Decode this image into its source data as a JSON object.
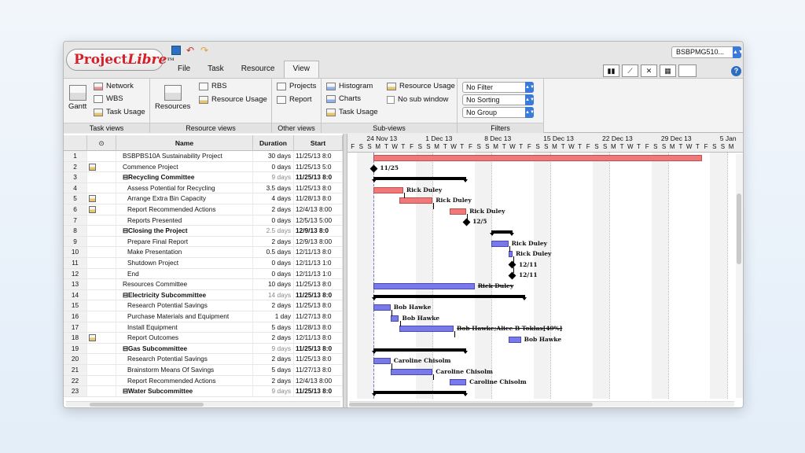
{
  "app": {
    "logo": "ProjectLibre",
    "logo_tm": "TM",
    "project_selector": "BSBPMG510..."
  },
  "menu": [
    "File",
    "Task",
    "Resource",
    "View"
  ],
  "ribbon": {
    "task_views": {
      "title": "Task views",
      "gantt": "Gantt",
      "network": "Network",
      "wbs": "WBS",
      "task_usage": "Task Usage"
    },
    "resource_views": {
      "title": "Resource views",
      "resources": "Resources",
      "rbs": "RBS",
      "resource_usage": "Resource Usage"
    },
    "other_views": {
      "title": "Other views",
      "projects": "Projects",
      "report": "Report"
    },
    "sub_views": {
      "title": "Sub-views",
      "histogram": "Histogram",
      "charts": "Charts",
      "task_usage": "Task Usage",
      "resource_usage": "Resource Usage",
      "no_sub_window": "No sub window"
    },
    "filters": {
      "title": "Filters",
      "filter": "No Filter",
      "sorting": "No Sorting",
      "group": "No Group"
    }
  },
  "table": {
    "columns": {
      "info": "⊙",
      "name": "Name",
      "duration": "Duration",
      "start": "Start"
    },
    "rows": [
      {
        "id": "1",
        "name": "BSBPBS10A Sustainability Project",
        "duration": "30 days",
        "start": "11/25/13 8:0",
        "level": 0,
        "summary": false,
        "note": false
      },
      {
        "id": "2",
        "name": "Commence Project",
        "duration": "0 days",
        "start": "11/25/13 5:0",
        "level": 0,
        "summary": false,
        "note": true
      },
      {
        "id": "3",
        "name": "⊟Recycling Committee",
        "duration": "9 days",
        "start": "11/25/13 8:0",
        "level": 0,
        "summary": true,
        "note": false
      },
      {
        "id": "4",
        "name": "Assess Potential for Recycling",
        "duration": "3.5 days",
        "start": "11/25/13 8:0",
        "level": 1,
        "summary": false,
        "note": false
      },
      {
        "id": "5",
        "name": "Arrange Extra Bin Capacity",
        "duration": "4 days",
        "start": "11/28/13 8:0",
        "level": 1,
        "summary": false,
        "note": true
      },
      {
        "id": "6",
        "name": "Report Recommended Actions",
        "duration": "2 days",
        "start": "12/4/13 8:00",
        "level": 1,
        "summary": false,
        "note": true
      },
      {
        "id": "7",
        "name": "Reports Presented",
        "duration": "0 days",
        "start": "12/5/13 5:00",
        "level": 1,
        "summary": false,
        "note": false
      },
      {
        "id": "8",
        "name": "⊟Closing the Project",
        "duration": "2.5 days",
        "start": "12/9/13 8:0",
        "level": 0,
        "summary": true,
        "note": false
      },
      {
        "id": "9",
        "name": "Prepare Final Report",
        "duration": "2 days",
        "start": "12/9/13 8:00",
        "level": 1,
        "summary": false,
        "note": false
      },
      {
        "id": "10",
        "name": "Make Presentation",
        "duration": "0.5 days",
        "start": "12/11/13 8:0",
        "level": 1,
        "summary": false,
        "note": false
      },
      {
        "id": "11",
        "name": "Shutdown Project",
        "duration": "0 days",
        "start": "12/11/13 1:0",
        "level": 1,
        "summary": false,
        "note": false
      },
      {
        "id": "12",
        "name": "End",
        "duration": "0 days",
        "start": "12/11/13 1:0",
        "level": 1,
        "summary": false,
        "note": false
      },
      {
        "id": "13",
        "name": "Resources Committee",
        "duration": "10 days",
        "start": "11/25/13 8:0",
        "level": 0,
        "summary": false,
        "note": false
      },
      {
        "id": "14",
        "name": "⊟Electricity Subcommittee",
        "duration": "14 days",
        "start": "11/25/13 8:0",
        "level": 0,
        "summary": true,
        "note": false
      },
      {
        "id": "15",
        "name": "Research Potential Savings",
        "duration": "2 days",
        "start": "11/25/13 8:0",
        "level": 1,
        "summary": false,
        "note": false
      },
      {
        "id": "16",
        "name": "Purchase Materials and Equipment",
        "duration": "1 day",
        "start": "11/27/13 8:0",
        "level": 1,
        "summary": false,
        "note": false
      },
      {
        "id": "17",
        "name": "Install Equipment",
        "duration": "5 days",
        "start": "11/28/13 8:0",
        "level": 1,
        "summary": false,
        "note": false
      },
      {
        "id": "18",
        "name": "Report Outcomes",
        "duration": "2 days",
        "start": "12/11/13 8:0",
        "level": 1,
        "summary": false,
        "note": true
      },
      {
        "id": "19",
        "name": "⊟Gas Subcommittee",
        "duration": "9 days",
        "start": "11/25/13 8:0",
        "level": 0,
        "summary": true,
        "note": false
      },
      {
        "id": "20",
        "name": "Research Potential Savings",
        "duration": "2 days",
        "start": "11/25/13 8:0",
        "level": 1,
        "summary": false,
        "note": false
      },
      {
        "id": "21",
        "name": "Brainstorm Means Of Savings",
        "duration": "5 days",
        "start": "11/27/13 8:0",
        "level": 1,
        "summary": false,
        "note": false
      },
      {
        "id": "22",
        "name": "Report Recommended Actions",
        "duration": "2 days",
        "start": "12/4/13 8:00",
        "level": 1,
        "summary": false,
        "note": false
      },
      {
        "id": "23",
        "name": "⊟Water Subcommittee",
        "duration": "9 days",
        "start": "11/25/13 8:0",
        "level": 0,
        "summary": true,
        "note": false
      }
    ]
  },
  "gantt": {
    "weeks": [
      "24 Nov 13",
      "1 Dec 13",
      "8 Dec 13",
      "15 Dec 13",
      "22 Dec 13",
      "29 Dec 13",
      "5 Jan"
    ],
    "first_day_letters": [
      "F",
      "S"
    ],
    "week_day_letters": [
      "S",
      "M",
      "T",
      "W",
      "T",
      "F",
      "S"
    ],
    "colors": {
      "task_bar": "#f07878",
      "resource_bar": "#7979ea",
      "summary_bar": "#000000"
    },
    "bars": [
      {
        "row": 0,
        "type": "red",
        "start": 2,
        "end": 41
      },
      {
        "row": 1,
        "type": "milestone",
        "at": 2,
        "label": "11/25"
      },
      {
        "row": 2,
        "type": "summary",
        "start": 2,
        "end": 13
      },
      {
        "row": 3,
        "type": "red",
        "start": 2,
        "end": 5.5,
        "label": "Rick Duley"
      },
      {
        "row": 4,
        "type": "red",
        "start": 5,
        "end": 9,
        "label": "Rick Duley"
      },
      {
        "row": 5,
        "type": "red",
        "start": 11,
        "end": 13,
        "label": "Rick Duley"
      },
      {
        "row": 6,
        "type": "milestone",
        "at": 13,
        "label": "12/5"
      },
      {
        "row": 7,
        "type": "summary",
        "start": 16,
        "end": 18.5
      },
      {
        "row": 8,
        "type": "blue",
        "start": 16,
        "end": 18,
        "label": "Rick Duley"
      },
      {
        "row": 9,
        "type": "blue",
        "start": 18,
        "end": 18.5,
        "label": "Rick Duley"
      },
      {
        "row": 10,
        "type": "milestone",
        "at": 18.5,
        "label": "12/11"
      },
      {
        "row": 11,
        "type": "milestone",
        "at": 18.5,
        "label": "12/11"
      },
      {
        "row": 12,
        "type": "blue",
        "start": 2,
        "end": 14,
        "label": "Rick Duley",
        "strike": true
      },
      {
        "row": 13,
        "type": "summary",
        "start": 2,
        "end": 20
      },
      {
        "row": 14,
        "type": "blue",
        "start": 2,
        "end": 4,
        "label": "Bob Hawke"
      },
      {
        "row": 15,
        "type": "blue",
        "start": 4,
        "end": 5,
        "label": "Bob Hawke"
      },
      {
        "row": 16,
        "type": "blue",
        "start": 5,
        "end": 11.5,
        "label": "Bob Hawke;Alice B Toklas[40%]",
        "strike": true
      },
      {
        "row": 17,
        "type": "blue",
        "start": 18,
        "end": 19.5,
        "label": "Bob Hawke"
      },
      {
        "row": 18,
        "type": "summary",
        "start": 2,
        "end": 13
      },
      {
        "row": 19,
        "type": "blue",
        "start": 2,
        "end": 4,
        "label": "Caroline Chisolm"
      },
      {
        "row": 20,
        "type": "blue",
        "start": 4,
        "end": 9,
        "label": "Caroline Chisolm"
      },
      {
        "row": 21,
        "type": "blue",
        "start": 11,
        "end": 13,
        "label": "Caroline Chisolm"
      },
      {
        "row": 22,
        "type": "summary",
        "start": 2,
        "end": 13
      }
    ],
    "links": [
      [
        3,
        4
      ],
      [
        4,
        5
      ],
      [
        5,
        6
      ],
      [
        8,
        9
      ],
      [
        9,
        10
      ],
      [
        10,
        11
      ],
      [
        14,
        15
      ],
      [
        15,
        16
      ],
      [
        16,
        17
      ],
      [
        19,
        20
      ],
      [
        20,
        21
      ]
    ]
  }
}
